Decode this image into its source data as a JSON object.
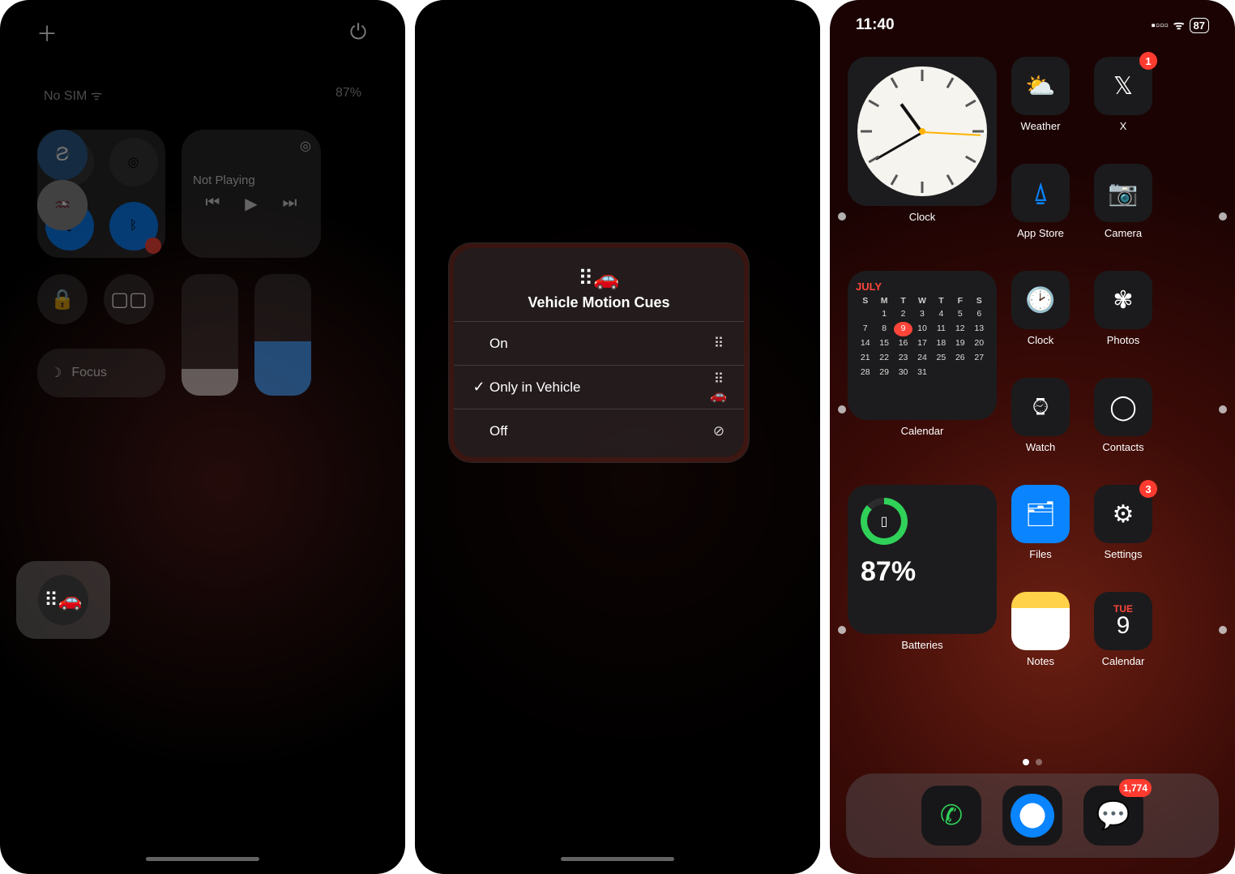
{
  "status_time": "11:40",
  "battery_pct": "87",
  "panel1": {
    "carrier": "No SIM",
    "battery_label": "87%",
    "media_label": "Not Playing",
    "focus_label": "Focus"
  },
  "vmc": {
    "title": "Vehicle Motion Cues",
    "options": [
      {
        "label": "On",
        "checked": false
      },
      {
        "label": "Only in Vehicle",
        "checked": true
      },
      {
        "label": "Off",
        "checked": false
      }
    ]
  },
  "home": {
    "widgets": {
      "clock_label": "Clock",
      "calendar_label": "Calendar",
      "calendar_month": "JULY",
      "calendar_today": 9,
      "batteries_label": "Batteries",
      "batteries_pct": "87%"
    },
    "apps_col": [
      {
        "name": "Weather",
        "badge": null
      },
      {
        "name": "X",
        "badge": "1"
      },
      {
        "name": "App Store",
        "badge": null
      },
      {
        "name": "Camera",
        "badge": null
      },
      {
        "name": "Clock",
        "badge": null
      },
      {
        "name": "Photos",
        "badge": null
      },
      {
        "name": "Watch",
        "badge": null
      },
      {
        "name": "Contacts",
        "badge": null
      },
      {
        "name": "Files",
        "badge": null
      },
      {
        "name": "Settings",
        "badge": "3"
      },
      {
        "name": "Notes",
        "badge": null
      },
      {
        "name": "Calendar",
        "badge": null,
        "day_abbrev": "TUE",
        "day_num": "9"
      }
    ],
    "dock": [
      {
        "name": "Phone",
        "badge": null
      },
      {
        "name": "Safari",
        "badge": null
      },
      {
        "name": "Messages",
        "badge": "1,774"
      }
    ]
  },
  "calendar_grid": {
    "dow": [
      "S",
      "M",
      "T",
      "W",
      "T",
      "F",
      "S"
    ],
    "weeks": [
      [
        "",
        "1",
        "2",
        "3",
        "4",
        "5",
        "6"
      ],
      [
        "7",
        "8",
        "9",
        "10",
        "11",
        "12",
        "13"
      ],
      [
        "14",
        "15",
        "16",
        "17",
        "18",
        "19",
        "20"
      ],
      [
        "21",
        "22",
        "23",
        "24",
        "25",
        "26",
        "27"
      ],
      [
        "28",
        "29",
        "30",
        "31",
        "",
        "",
        ""
      ]
    ]
  }
}
